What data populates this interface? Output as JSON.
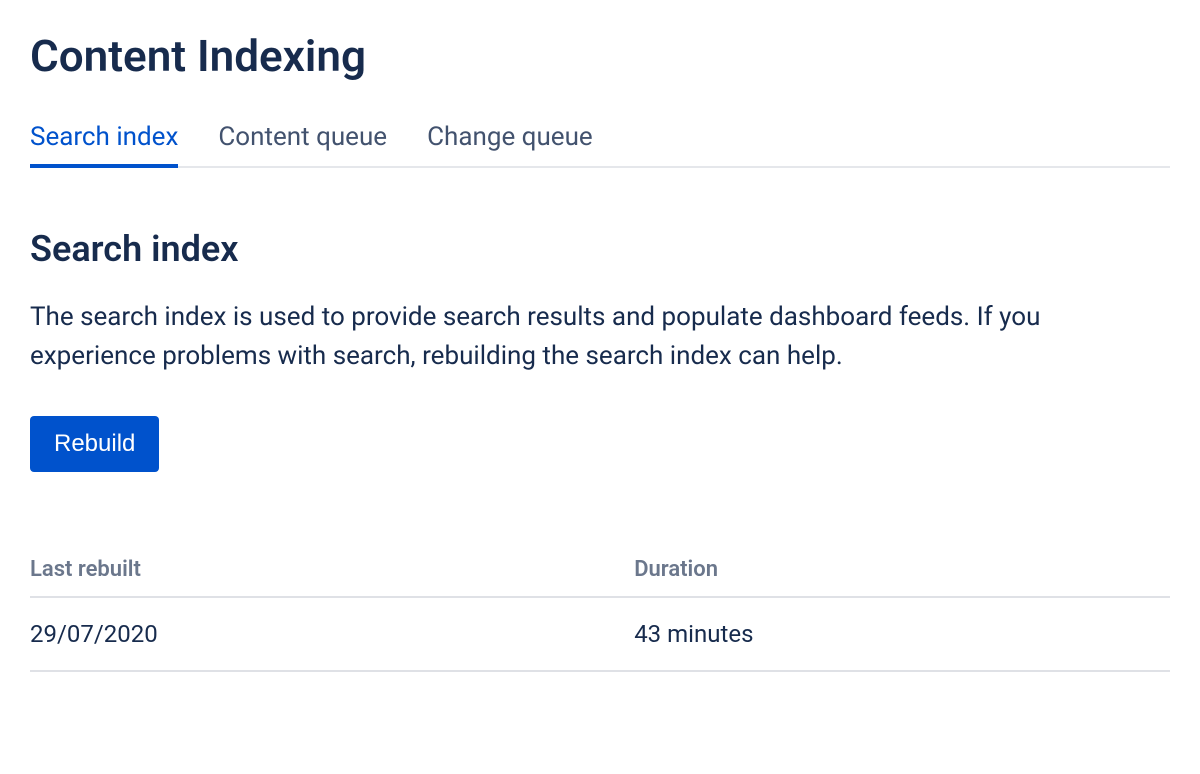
{
  "page": {
    "title": "Content Indexing"
  },
  "tabs": [
    {
      "label": "Search index",
      "active": true
    },
    {
      "label": "Content queue",
      "active": false
    },
    {
      "label": "Change queue",
      "active": false
    }
  ],
  "section": {
    "title": "Search index",
    "description": "The search index is used to provide search results and populate dashboard feeds. If you experience problems with search, rebuilding the search index can help.",
    "rebuild_label": "Rebuild"
  },
  "table": {
    "headers": {
      "last_rebuilt": "Last rebuilt",
      "duration": "Duration"
    },
    "row": {
      "last_rebuilt": "29/07/2020",
      "duration": "43 minutes"
    }
  }
}
